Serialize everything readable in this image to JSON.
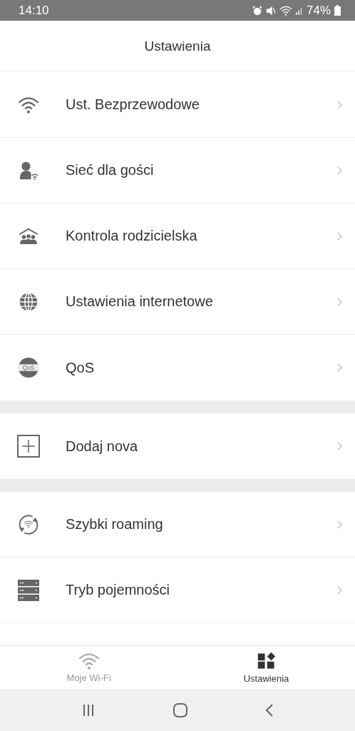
{
  "status_bar": {
    "time": "14:10",
    "battery": "74%"
  },
  "header": {
    "title": "Ustawienia"
  },
  "sections": [
    {
      "items": [
        {
          "kind": "wifi",
          "label": "Ust. Bezprzewodowe"
        },
        {
          "kind": "guest",
          "label": "Sieć dla gości"
        },
        {
          "kind": "parental",
          "label": "Kontrola rodzicielska"
        },
        {
          "kind": "globe",
          "label": "Ustawienia internetowe"
        },
        {
          "kind": "qos",
          "label": "QoS",
          "badge": "QoS"
        }
      ]
    },
    {
      "items": [
        {
          "kind": "add",
          "label": "Dodaj nova"
        }
      ]
    },
    {
      "items": [
        {
          "kind": "roaming",
          "label": "Szybki roaming"
        },
        {
          "kind": "capacity",
          "label": "Tryb pojemności"
        }
      ]
    }
  ],
  "tab_bar": [
    {
      "kind": "wifi",
      "label": "Moje Wi-Fi",
      "selected": false
    },
    {
      "kind": "settings",
      "label": "Ustawienia",
      "selected": true
    }
  ]
}
